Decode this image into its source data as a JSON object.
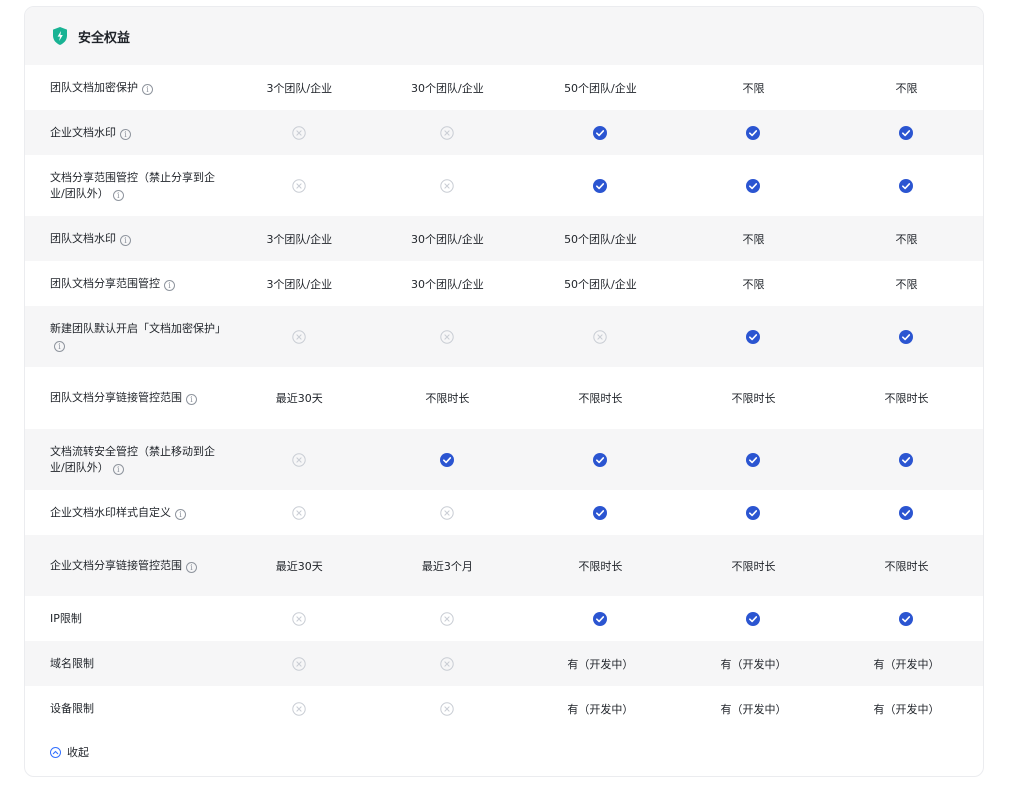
{
  "section": {
    "title": "安全权益"
  },
  "rows": [
    {
      "label": "团队文档加密保护",
      "info": true,
      "h": 45,
      "alt": false,
      "cells": [
        {
          "t": "text",
          "v": "3个团队/企业"
        },
        {
          "t": "text",
          "v": "30个团队/企业"
        },
        {
          "t": "text",
          "v": "50个团队/企业"
        },
        {
          "t": "text",
          "v": "不限"
        },
        {
          "t": "text",
          "v": "不限"
        }
      ]
    },
    {
      "label": "企业文档水印",
      "info": true,
      "h": 45,
      "alt": true,
      "cells": [
        {
          "t": "no"
        },
        {
          "t": "no"
        },
        {
          "t": "yes"
        },
        {
          "t": "yes"
        },
        {
          "t": "yes"
        }
      ]
    },
    {
      "label": "文档分享范围管控（禁止分享到企业/团队外）",
      "info": true,
      "h": 61,
      "alt": false,
      "cells": [
        {
          "t": "no"
        },
        {
          "t": "no"
        },
        {
          "t": "yes"
        },
        {
          "t": "yes"
        },
        {
          "t": "yes"
        }
      ]
    },
    {
      "label": "团队文档水印",
      "info": true,
      "h": 45,
      "alt": true,
      "cells": [
        {
          "t": "text",
          "v": "3个团队/企业"
        },
        {
          "t": "text",
          "v": "30个团队/企业"
        },
        {
          "t": "text",
          "v": "50个团队/企业"
        },
        {
          "t": "text",
          "v": "不限"
        },
        {
          "t": "text",
          "v": "不限"
        }
      ]
    },
    {
      "label": "团队文档分享范围管控",
      "info": true,
      "h": 45,
      "alt": false,
      "cells": [
        {
          "t": "text",
          "v": "3个团队/企业"
        },
        {
          "t": "text",
          "v": "30个团队/企业"
        },
        {
          "t": "text",
          "v": "50个团队/企业"
        },
        {
          "t": "text",
          "v": "不限"
        },
        {
          "t": "text",
          "v": "不限"
        }
      ]
    },
    {
      "label": "新建团队默认开启「文档加密保护」",
      "info": true,
      "h": 61,
      "alt": true,
      "cells": [
        {
          "t": "no"
        },
        {
          "t": "no"
        },
        {
          "t": "no"
        },
        {
          "t": "yes"
        },
        {
          "t": "yes"
        }
      ]
    },
    {
      "label": "团队文档分享链接管控范围",
      "info": true,
      "h": 62,
      "alt": false,
      "cells": [
        {
          "t": "text",
          "v": "最近30天"
        },
        {
          "t": "text",
          "v": "不限时长"
        },
        {
          "t": "text",
          "v": "不限时长"
        },
        {
          "t": "text",
          "v": "不限时长"
        },
        {
          "t": "text",
          "v": "不限时长"
        }
      ]
    },
    {
      "label": "文档流转安全管控（禁止移动到企业/团队外）",
      "info": true,
      "h": 61,
      "alt": true,
      "cells": [
        {
          "t": "no"
        },
        {
          "t": "yes"
        },
        {
          "t": "yes"
        },
        {
          "t": "yes"
        },
        {
          "t": "yes"
        }
      ]
    },
    {
      "label": "企业文档水印样式自定义",
      "info": true,
      "h": 45,
      "alt": false,
      "cells": [
        {
          "t": "no"
        },
        {
          "t": "no"
        },
        {
          "t": "yes"
        },
        {
          "t": "yes"
        },
        {
          "t": "yes"
        }
      ]
    },
    {
      "label": "企业文档分享链接管控范围",
      "info": true,
      "h": 61,
      "alt": true,
      "cells": [
        {
          "t": "text",
          "v": "最近30天"
        },
        {
          "t": "text",
          "v": "最近3个月"
        },
        {
          "t": "text",
          "v": "不限时长"
        },
        {
          "t": "text",
          "v": "不限时长"
        },
        {
          "t": "text",
          "v": "不限时长"
        }
      ]
    },
    {
      "label": "IP限制",
      "info": false,
      "h": 45,
      "alt": false,
      "cells": [
        {
          "t": "no"
        },
        {
          "t": "no"
        },
        {
          "t": "yes"
        },
        {
          "t": "yes"
        },
        {
          "t": "yes"
        }
      ]
    },
    {
      "label": "域名限制",
      "info": false,
      "h": 45,
      "alt": true,
      "cells": [
        {
          "t": "no"
        },
        {
          "t": "no"
        },
        {
          "t": "text",
          "v": "有（开发中）"
        },
        {
          "t": "text",
          "v": "有（开发中）"
        },
        {
          "t": "text",
          "v": "有（开发中）"
        }
      ]
    },
    {
      "label": "设备限制",
      "info": false,
      "h": 45,
      "alt": false,
      "cells": [
        {
          "t": "no"
        },
        {
          "t": "no"
        },
        {
          "t": "text",
          "v": "有（开发中）"
        },
        {
          "t": "text",
          "v": "有（开发中）"
        },
        {
          "t": "text",
          "v": "有（开发中）"
        }
      ]
    }
  ],
  "collapse": {
    "label": "收起"
  },
  "colors": {
    "accent": "#2b55d1",
    "brand_green": "#19b394",
    "cross": "#c9cdd4",
    "alt_bg": "#f6f6f7"
  },
  "icons": {
    "header": "shield-icon",
    "included": "check-icon",
    "excluded": "cross-icon",
    "info": "info-icon",
    "collapse": "chevron-up-icon"
  }
}
